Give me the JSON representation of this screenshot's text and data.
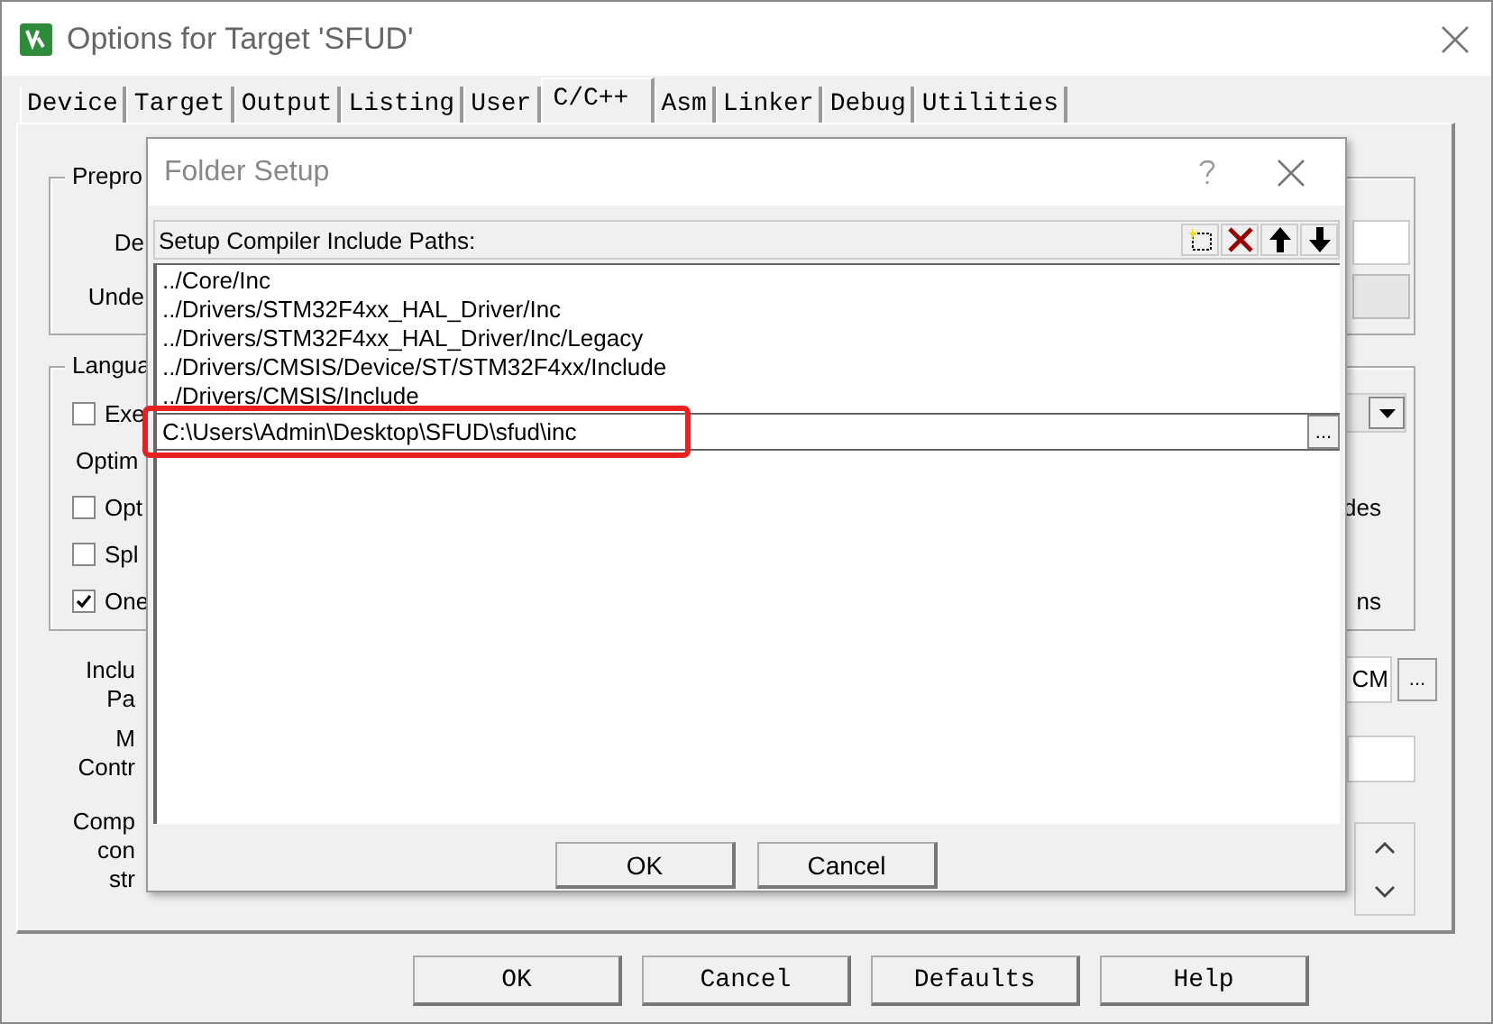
{
  "window": {
    "title": "Options for Target 'SFUD'"
  },
  "tabs": [
    {
      "label": "Device",
      "selected": false
    },
    {
      "label": "Target",
      "selected": false
    },
    {
      "label": "Output",
      "selected": false
    },
    {
      "label": "Listing",
      "selected": false
    },
    {
      "label": "User",
      "selected": false
    },
    {
      "label": "C/C++",
      "selected": true
    },
    {
      "label": "Asm",
      "selected": false
    },
    {
      "label": "Linker",
      "selected": false
    },
    {
      "label": "Debug",
      "selected": false
    },
    {
      "label": "Utilities",
      "selected": false
    }
  ],
  "preprocessor_group": {
    "title": "Prepro",
    "rows": [
      {
        "label": "De",
        "disabled": false
      },
      {
        "label": "Unde",
        "disabled": true
      }
    ]
  },
  "language_group": {
    "title": "Langua",
    "rows": [
      {
        "kind": "checkbox",
        "label": "Exe",
        "checked": false,
        "right": {
          "kind": "dropdown"
        }
      },
      {
        "kind": "label",
        "label": "Optim"
      },
      {
        "kind": "checkbox",
        "label": "Opt",
        "checked": false,
        "right": {
          "kind": "text",
          "text": "des"
        }
      },
      {
        "kind": "checkbox",
        "label": "Spl",
        "checked": false
      },
      {
        "kind": "checkbox",
        "label": "One",
        "checked": true,
        "right": {
          "kind": "text",
          "text": "ns"
        }
      }
    ]
  },
  "misc_rows": [
    {
      "label_lines": [
        "Inclu",
        "Pa"
      ],
      "right": {
        "kind": "path_field",
        "value": "CM",
        "browse": "..."
      }
    },
    {
      "label_lines": [
        "M",
        "Contr"
      ],
      "right": {
        "kind": "field"
      }
    },
    {
      "label_lines": [
        "Comp",
        "con",
        "str"
      ],
      "right": {
        "kind": "scroll_box"
      }
    }
  ],
  "buttons": [
    "OK",
    "Cancel",
    "Defaults",
    "Help"
  ],
  "folder_setup": {
    "title": "Folder Setup",
    "heading": "Setup Compiler Include Paths:",
    "paths": [
      {
        "text": "../Core/Inc"
      },
      {
        "text": "../Drivers/STM32F4xx_HAL_Driver/Inc"
      },
      {
        "text": "../Drivers/STM32F4xx_HAL_Driver/Inc/Legacy"
      },
      {
        "text": "../Drivers/CMSIS/Device/ST/STM32F4xx/Include"
      },
      {
        "text": "../Drivers/CMSIS/Include"
      }
    ],
    "editing": {
      "value": "C:\\Users\\Admin\\Desktop\\SFUD\\sfud\\inc",
      "browse": "...",
      "highlighted": true
    },
    "buttons": [
      "OK",
      "Cancel"
    ]
  }
}
